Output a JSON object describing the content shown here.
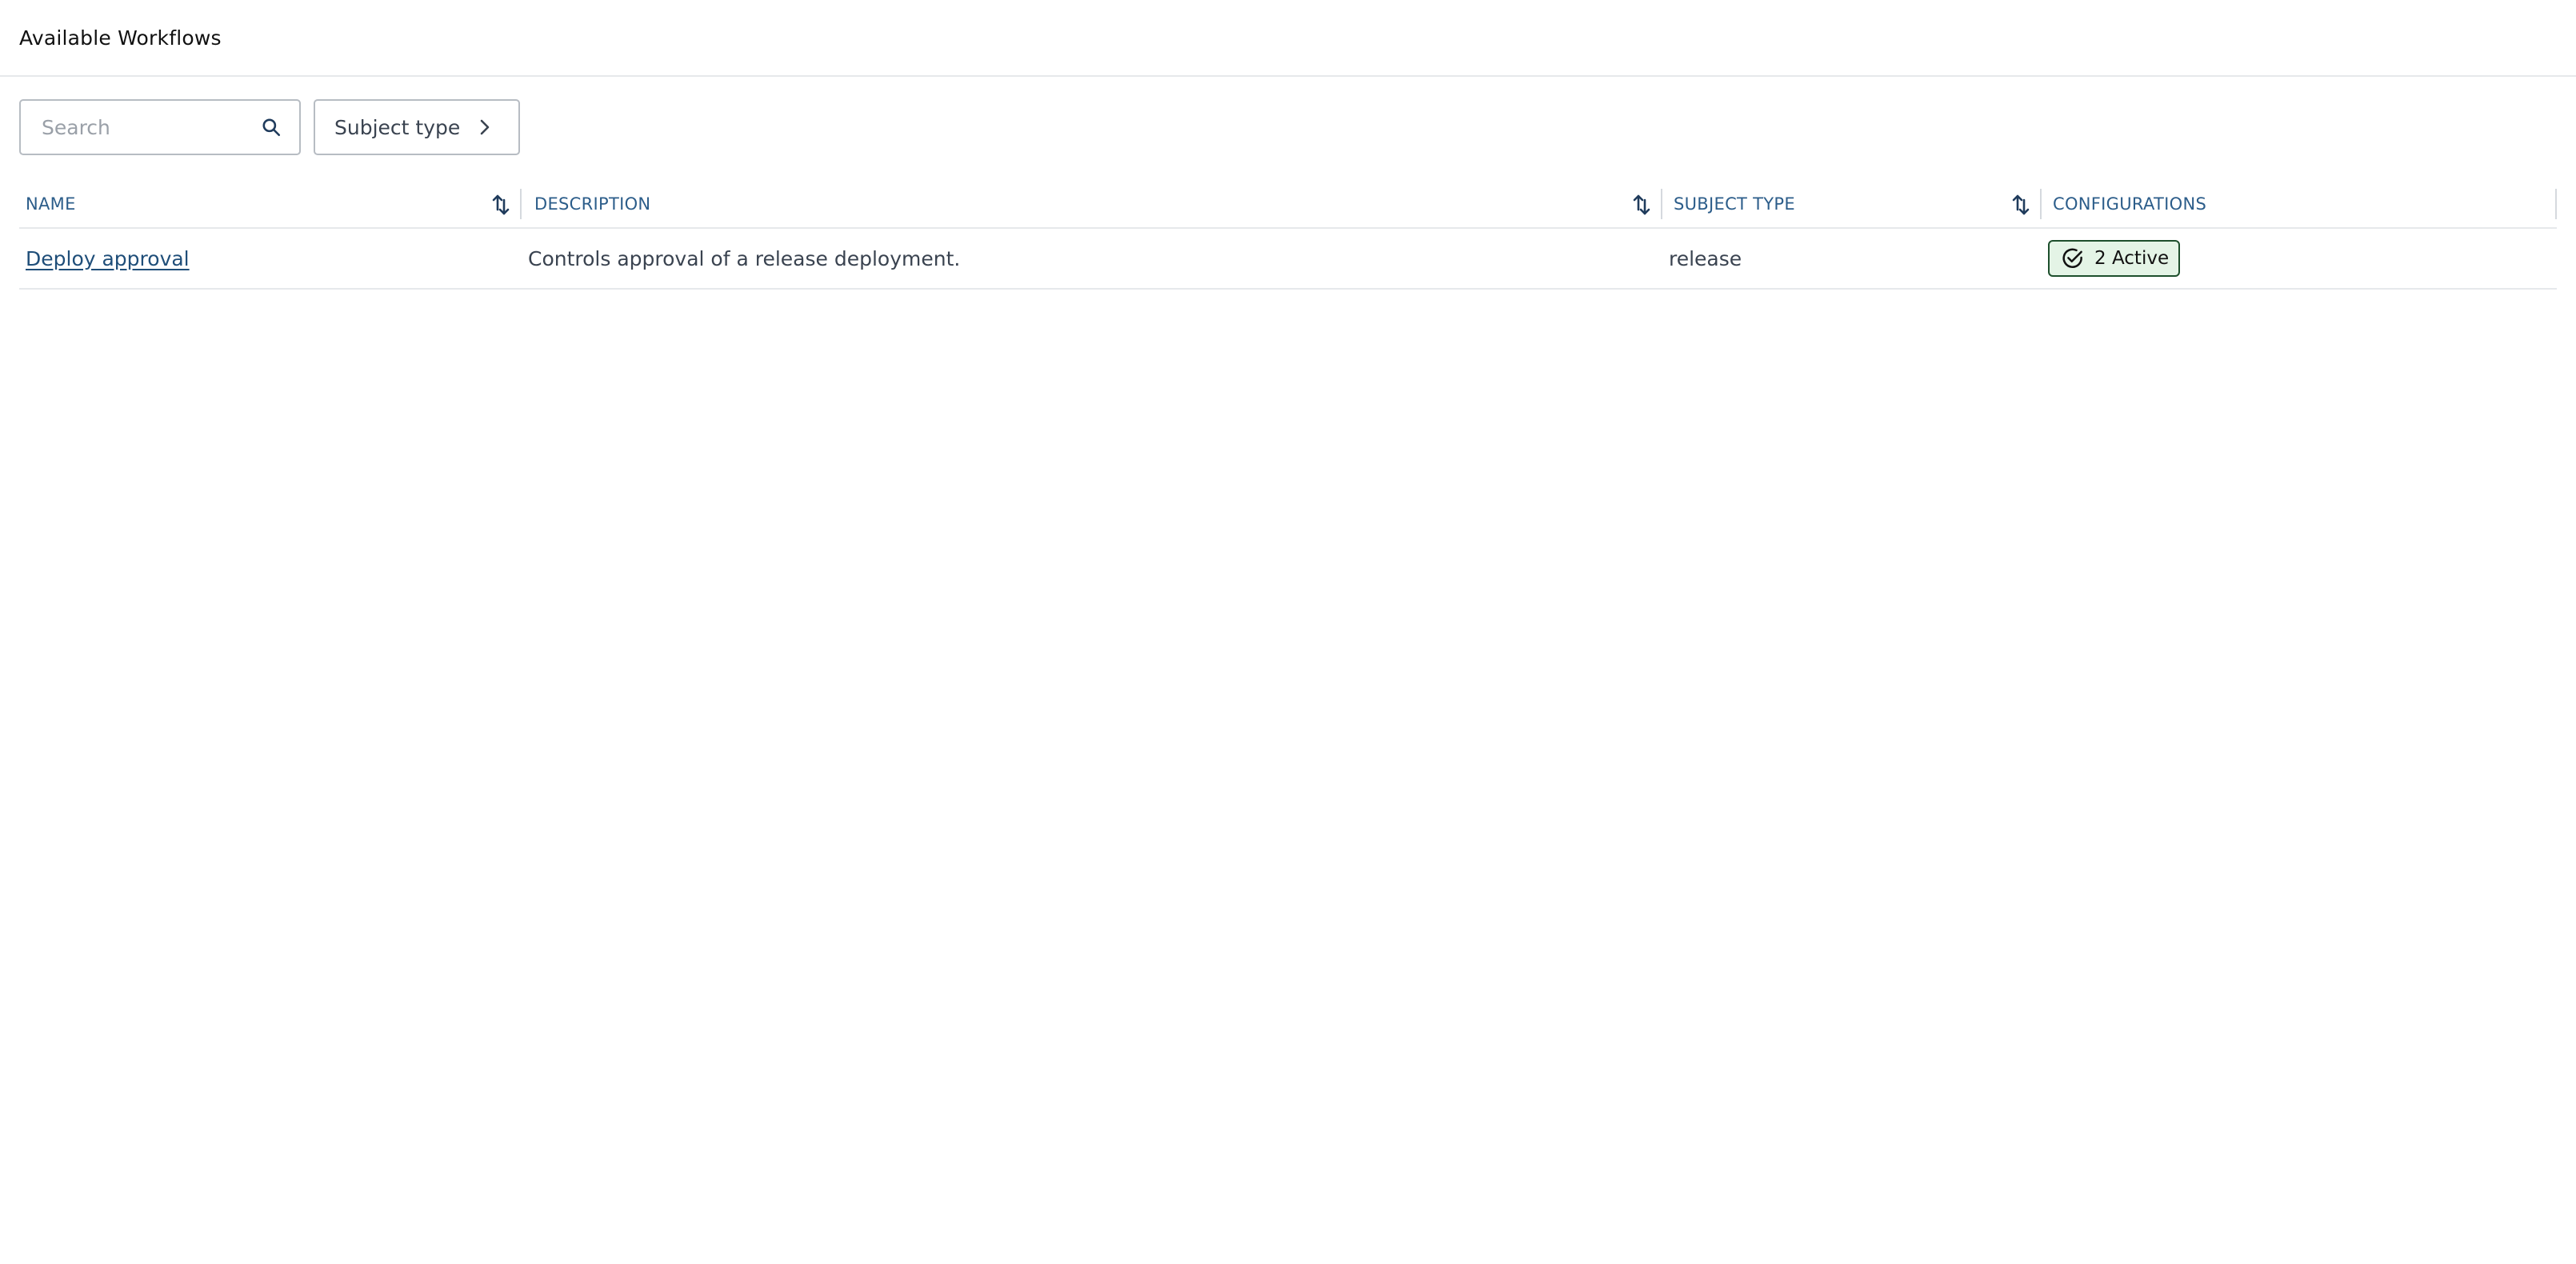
{
  "header": {
    "title": "Available Workflows"
  },
  "toolbar": {
    "search_placeholder": "Search",
    "search_value": "",
    "search_icon": "search-icon",
    "filter_label": "Subject type",
    "filter_icon": "chevron-right-icon"
  },
  "table": {
    "columns": [
      {
        "label": "NAME",
        "sortable": true
      },
      {
        "label": "DESCRIPTION",
        "sortable": true
      },
      {
        "label": "SUBJECT TYPE",
        "sortable": true
      },
      {
        "label": "CONFIGURATIONS",
        "sortable": false
      }
    ],
    "rows": [
      {
        "name": "Deploy approval",
        "description": "Controls approval of a release deployment.",
        "subject_type": "release",
        "configurations": "2 Active",
        "configurations_icon": "check-circle-icon"
      }
    ]
  },
  "colors": {
    "link": "#1f4e79",
    "header_text": "#2c5d8a",
    "badge_bg": "#e4f4e6",
    "badge_border": "#1d4f2c"
  }
}
